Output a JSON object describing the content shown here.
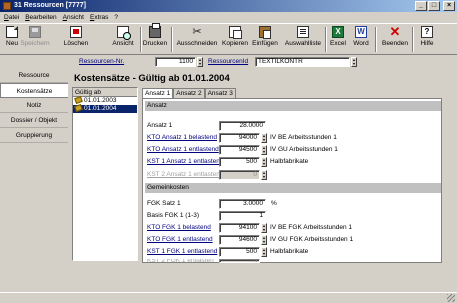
{
  "window": {
    "title": "31 Ressourcen [7777]"
  },
  "menu": [
    "Datei",
    "Bearbeiten",
    "Ansicht",
    "Extras",
    "?"
  ],
  "toolbar": {
    "neu": "Neu",
    "speichern": "Speichern",
    "loeschen": "Löschen",
    "ansicht": "Ansicht",
    "drucken": "Drucken",
    "ausschneiden": "Ausschneiden",
    "kopieren": "Kopieren",
    "einfuegen": "Einfügen",
    "auswahlliste": "Auswahlliste",
    "excel": "Excel",
    "word": "Word",
    "beenden": "Beenden",
    "hilfe": "Hilfe"
  },
  "record": {
    "nr_label": "Ressourcen-Nr.",
    "nr_value": "1100",
    "id_label": "RessourcenId",
    "id_value": "TEXTILKONTR"
  },
  "nav": [
    "Ressource",
    "Kostensätze",
    "Notiz",
    "Dossier / Objekt",
    "Gruppierung"
  ],
  "page_title": "Kostensätze - Gültig ab 01.01.2004",
  "validity": {
    "header": "Gültig ab",
    "items": [
      "01.01.2003",
      "01.01.2004"
    ]
  },
  "tabs": [
    "Ansatz 1",
    "Ansatz 2",
    "Ansatz 3"
  ],
  "ansatz": {
    "section": "Ansatz",
    "rows": [
      {
        "label": "Ansatz 1",
        "value": "28.0000",
        "desc": ""
      },
      {
        "label": "KTO Ansatz 1 belastend",
        "value": "94000",
        "desc": "IV BE Arbeitsstunden 1"
      },
      {
        "label": "KTO Ansatz 1 entlastend",
        "value": "94500",
        "desc": "IV GU Arbeitsstunden 1"
      },
      {
        "label": "KST 1 Ansatz 1 entlasten",
        "value": "500",
        "desc": "Halbfabrikate"
      },
      {
        "label": "KST 2 Ansatz 1 entlasten",
        "value": "0",
        "desc": ""
      }
    ]
  },
  "gemeinkosten": {
    "section": "Gemeinkosten",
    "rows": [
      {
        "label": "FGK Satz 1",
        "value": "3.0000",
        "desc": "%"
      },
      {
        "label": "Basis FGK 1 (1-3)",
        "value": "1",
        "desc": ""
      },
      {
        "label": "KTO FGK 1 belastend",
        "value": "94100",
        "desc": "IV BE FGK Arbeitsstunden 1"
      },
      {
        "label": "KTO FGK 1 entlastend",
        "value": "94600",
        "desc": "IV GU FGK Arbeitsstunden 1"
      },
      {
        "label": "KST 1 FGK 1 entlastend",
        "value": "500",
        "desc": "Halbfabrikate"
      },
      {
        "label": "KST 2 FGK 1 entlasten",
        "value": "0",
        "desc": ""
      }
    ]
  }
}
